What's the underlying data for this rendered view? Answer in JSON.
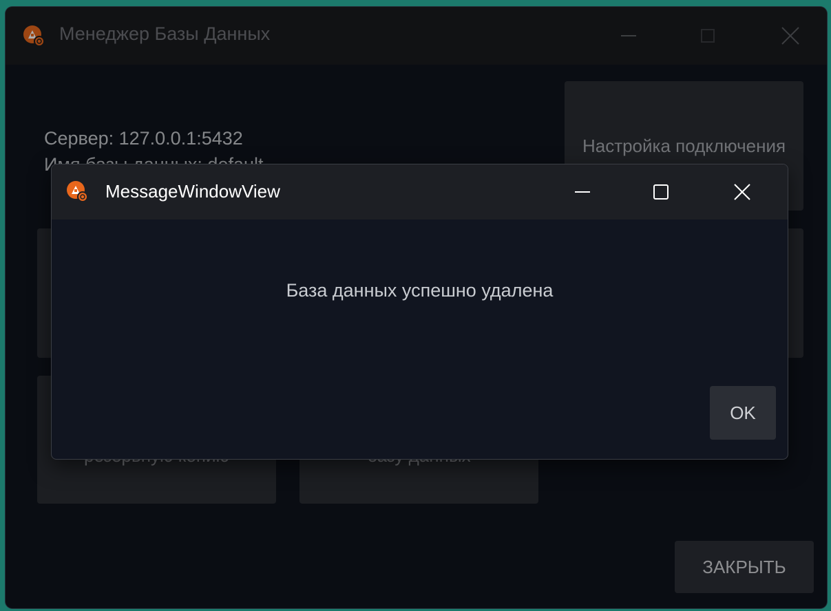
{
  "main_window": {
    "title": "Менеджер Базы Данных",
    "server_text": "Сервер: 127.0.0.1:5432",
    "db_text": "Имя базы данных: default",
    "tiles": {
      "settings": "Настройка подключения",
      "left_mid": "",
      "right_mid": "",
      "backup": "резервную копию",
      "delete": "базу данных"
    },
    "close_button": "ЗАКРЫТЬ"
  },
  "dialog": {
    "title": "MessageWindowView",
    "message": "База данных успешно удалена",
    "ok_label": "OK"
  },
  "colors": {
    "accent": "#e8671c",
    "desktop": "#1c7a6c",
    "window_bg": "#10141d",
    "tile_bg": "#2a2d33"
  },
  "icons": {
    "app": "app-logo-icon",
    "minimize": "minimize-icon",
    "maximize": "maximize-icon",
    "close": "close-icon"
  }
}
